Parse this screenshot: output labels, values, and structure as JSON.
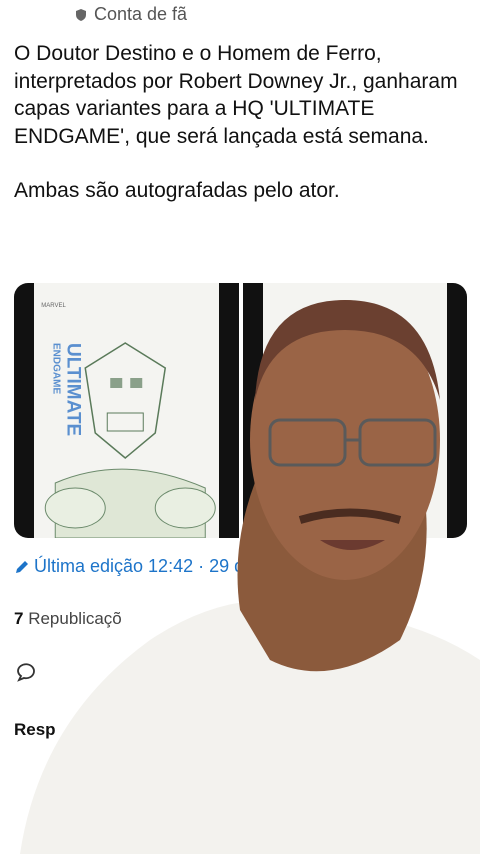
{
  "header": {
    "label": "Conta de fã",
    "icon": "shield-icon"
  },
  "tweet": {
    "text": "O Doutor Destino e o Homem de Ferro, interpretados por Robert Downey Jr., ganharam capas variantes para a HQ 'ULTIMATE ENDGAME', que será lançada está semana.",
    "text2": "Ambas são autografadas pelo ator."
  },
  "media": {
    "cover_title": "ULTIMATE",
    "cover_subtitle": "ENDGAME",
    "cover_brand": "MARVEL"
  },
  "meta": {
    "edited": "Última edição 12:42 · 29 d",
    "icon": "pencil-icon",
    "color": "#1d74c9"
  },
  "stats": {
    "count": "7",
    "label": "Republicaçõ"
  },
  "actions": {
    "reply_icon": "comment-icon"
  },
  "responses": {
    "label": "Resp"
  }
}
